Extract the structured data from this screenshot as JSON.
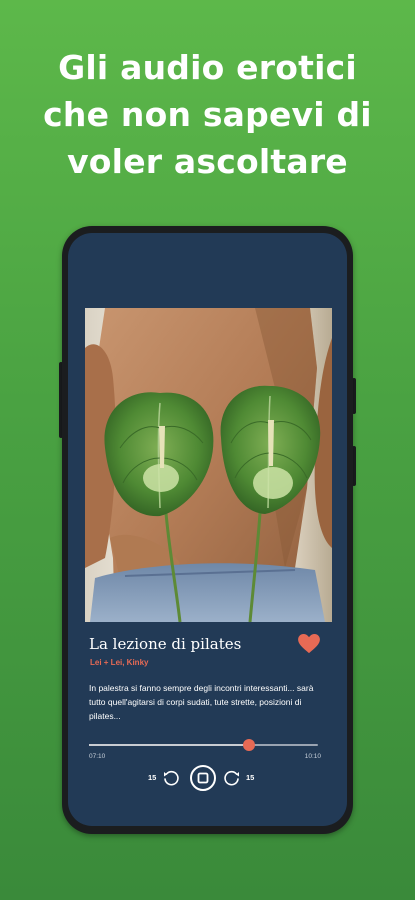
{
  "headline": {
    "line1": "Gli audio erotici",
    "line2": "che non sapevi di",
    "line3": "voler ascoltare"
  },
  "player": {
    "title": "La lezione di pilates",
    "tags": "Lei + Lei, Kinky",
    "description": "In palestra si fanno sempre degli incontri interessanti... sarà tutto quell'agitarsi di corpi sudati, tute strette, posizioni di pilates...",
    "elapsed": "07:10",
    "total": "10:10",
    "progress": 0.7,
    "rewind_seconds": "15",
    "forward_seconds": "15",
    "favorited": true
  },
  "colors": {
    "background_top": "#5db84a",
    "background_bottom": "#3a8a3a",
    "screen": "#223a56",
    "accent": "#e76a55"
  },
  "icons": {
    "heart": "heart-icon",
    "rewind": "rewind-15-icon",
    "stop": "stop-icon",
    "forward": "forward-15-icon"
  }
}
